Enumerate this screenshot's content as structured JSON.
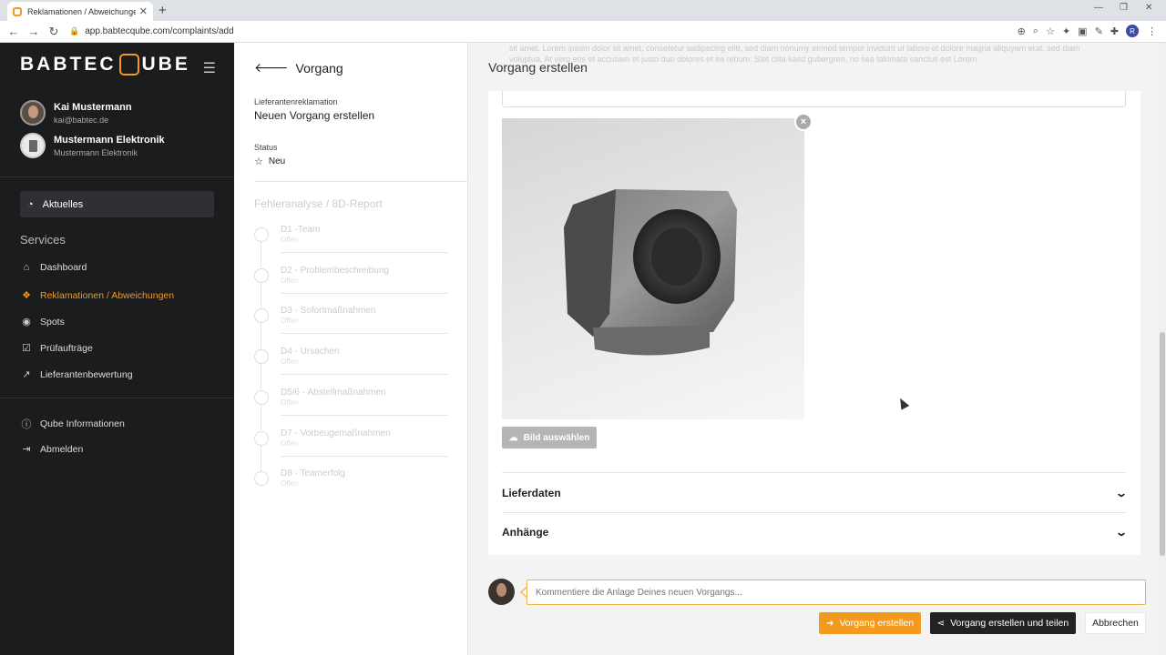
{
  "browser": {
    "tab_title": "Reklamationen / Abweichungen",
    "url": "app.babtecqube.com/complaints/add",
    "profile_initial": "R"
  },
  "sidebar": {
    "logo_left": "BABTEC",
    "logo_right": "UBE",
    "user": {
      "name": "Kai Mustermann",
      "email": "kai@babtec.de"
    },
    "company": {
      "name": "Mustermann Elektronik",
      "sub": "Mustermann Elektronik"
    },
    "active_item": "Aktuelles",
    "services_heading": "Services",
    "items": [
      {
        "label": "Dashboard",
        "icon": "home-icon"
      },
      {
        "label": "Reklamationen / Abweichungen",
        "icon": "cubes-icon",
        "active": true
      },
      {
        "label": "Spots",
        "icon": "target-icon"
      },
      {
        "label": "Prüfaufträge",
        "icon": "checkbox-icon"
      },
      {
        "label": "Lieferantenbewertung",
        "icon": "chart-line-icon"
      }
    ],
    "footer_items": [
      {
        "label": "Qube Informationen",
        "icon": "info-icon"
      },
      {
        "label": "Abmelden",
        "icon": "sign-out-icon"
      }
    ]
  },
  "midpanel": {
    "title": "Vorgang",
    "type_label": "Lieferantenreklamation",
    "type_value": "Neuen Vorgang erstellen",
    "status_label": "Status",
    "status_value": "Neu",
    "analysis_heading": "Fehleranalyse / 8D-Report",
    "steps": [
      {
        "title": "D1 -Team",
        "sub": "Offen"
      },
      {
        "title": "D2 - Problembeschreibung",
        "sub": "Offen"
      },
      {
        "title": "D3 - Sofortmaßnahmen",
        "sub": "Offen"
      },
      {
        "title": "D4 - Ursachen",
        "sub": "Offen"
      },
      {
        "title": "D5/6 - Abstellmaßnahmen",
        "sub": "Offen"
      },
      {
        "title": "D7 - Vorbeugemaßnahmen",
        "sub": "Offen"
      },
      {
        "title": "D8 - Teamerfolg",
        "sub": "Offen"
      }
    ]
  },
  "main": {
    "title": "Vorgang erstellen",
    "ghost_text": "sit amet. Lorem ipsum dolor sit amet, consetetur sadipscing elitr, sed diam nonumy eirmod tempor invidunt ut labore et dolore magna aliquyam erat, sed diam voluptua. At vero eos et accusam et justo duo dolores et ea rebum. Stet clita kasd gubergren, no sea takimata sanctus est Lorem",
    "upload_label": "Bild auswählen",
    "remove_label": "×",
    "sections": [
      "Lieferdaten",
      "Anhänge"
    ],
    "comment_placeholder": "Kommentiere die Anlage Deines neuen Vorgangs...",
    "buttons": {
      "create": "Vorgang erstellen",
      "create_share": "Vorgang erstellen und teilen",
      "cancel": "Abbrechen"
    }
  },
  "colors": {
    "accent": "#f39a1e",
    "sidebar_bg": "#1b1c1e"
  }
}
